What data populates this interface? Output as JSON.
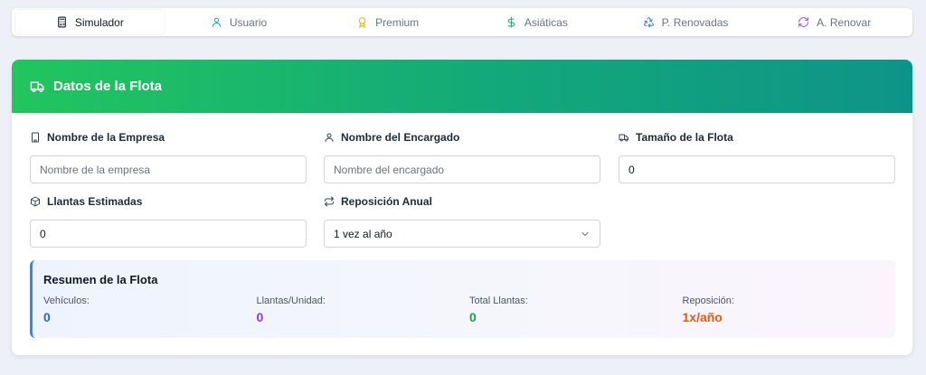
{
  "tabs": [
    {
      "label": "Simulador",
      "icon": "calculator-icon",
      "color": "#111827"
    },
    {
      "label": "Usuario",
      "icon": "user-icon",
      "color": "#06b6d4"
    },
    {
      "label": "Premium",
      "icon": "award-icon",
      "color": "#eab308"
    },
    {
      "label": "Asiáticas",
      "icon": "dollar-icon",
      "color": "#10b981"
    },
    {
      "label": "P. Renovadas",
      "icon": "recycle-icon",
      "color": "#3b82f6"
    },
    {
      "label": "A. Renovar",
      "icon": "refresh-icon",
      "color": "#a855f7"
    }
  ],
  "card": {
    "title": "Datos de la Flota"
  },
  "fields": {
    "empresa": {
      "label": "Nombre de la Empresa",
      "placeholder": "Nombre de la empresa",
      "value": ""
    },
    "encargado": {
      "label": "Nombre del Encargado",
      "placeholder": "Nombre del encargado",
      "value": ""
    },
    "flota": {
      "label": "Tamaño de la Flota",
      "value": "0"
    },
    "llantas": {
      "label": "Llantas Estimadas",
      "value": "0"
    },
    "reposicion": {
      "label": "Reposición Anual",
      "value": "1 vez al año"
    }
  },
  "summary": {
    "title": "Resumen de la Flota",
    "stats": [
      {
        "label": "Vehículos:",
        "value": "0",
        "color": "#2563eb"
      },
      {
        "label": "Llantas/Unidad:",
        "value": "0",
        "color": "#9333ea"
      },
      {
        "label": "Total Llantas:",
        "value": "0",
        "color": "#16a34a"
      },
      {
        "label": "Reposición:",
        "value": "1x/año",
        "color": "#ea580c"
      }
    ]
  }
}
